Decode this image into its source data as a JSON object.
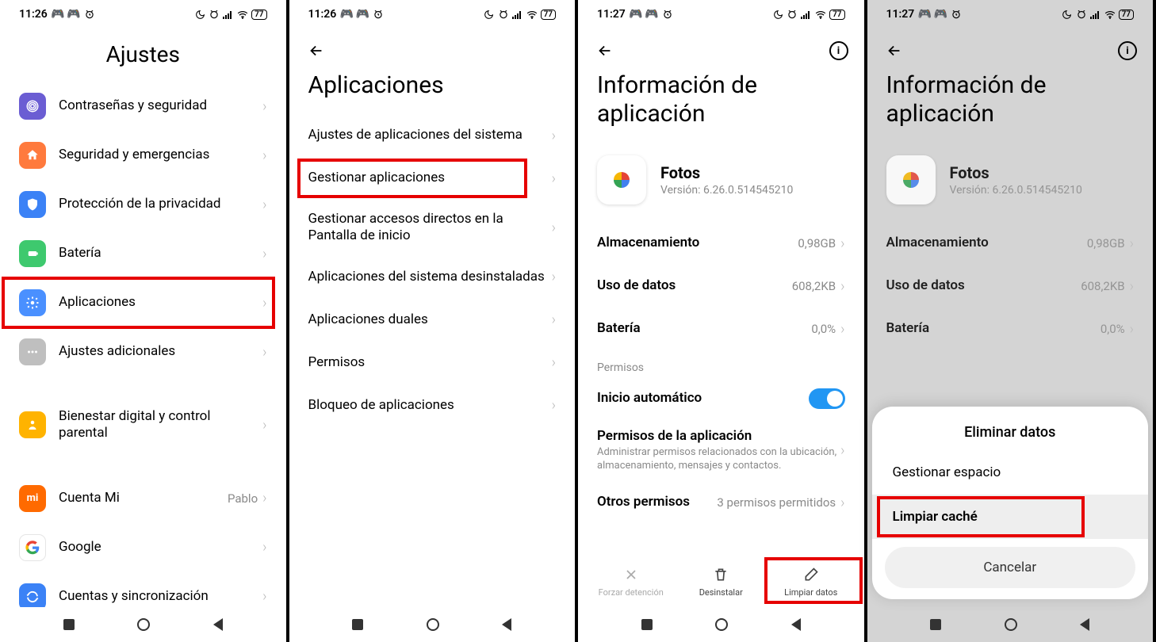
{
  "status": {
    "time1": "11:26",
    "time2": "11:27",
    "battery": "77"
  },
  "screen1": {
    "title": "Ajustes",
    "items": [
      {
        "label": "Contraseñas y seguridad"
      },
      {
        "label": "Seguridad y emergencias"
      },
      {
        "label": "Protección de la privacidad"
      },
      {
        "label": "Batería"
      },
      {
        "label": "Aplicaciones"
      },
      {
        "label": "Ajustes adicionales"
      },
      {
        "label": "Bienestar digital y control parental"
      },
      {
        "label": "Cuenta Mi",
        "value": "Pablo"
      },
      {
        "label": "Google"
      },
      {
        "label": "Cuentas y sincronización"
      }
    ]
  },
  "screen2": {
    "title": "Aplicaciones",
    "items": [
      {
        "label": "Ajustes de aplicaciones del sistema"
      },
      {
        "label": "Gestionar aplicaciones"
      },
      {
        "label": "Gestionar accesos directos en la Pantalla de inicio"
      },
      {
        "label": "Aplicaciones del sistema desinstaladas"
      },
      {
        "label": "Aplicaciones duales"
      },
      {
        "label": "Permisos"
      },
      {
        "label": "Bloqueo de aplicaciones"
      }
    ]
  },
  "screen3": {
    "title": "Información de aplicación",
    "app_name": "Fotos",
    "app_version": "Versión: 6.26.0.514545210",
    "rows": [
      {
        "label": "Almacenamiento",
        "value": "0,98GB"
      },
      {
        "label": "Uso de datos",
        "value": "608,2KB"
      },
      {
        "label": "Batería",
        "value": "0,0%"
      }
    ],
    "section_permisos": "Permisos",
    "autostart": "Inicio automático",
    "app_perms_title": "Permisos de la aplicación",
    "app_perms_sub": "Administrar permisos relacionados con la ubicación, almacenamiento, mensajes y contactos.",
    "other_perms": "Otros permisos",
    "other_perms_value": "3 permisos permitidos",
    "actions": {
      "forcestop": "Forzar detención",
      "uninstall": "Desinstalar",
      "cleardata": "Limpiar datos"
    }
  },
  "screen4": {
    "dialog_title": "Eliminar datos",
    "opt_manage": "Gestionar espacio",
    "opt_clear": "Limpiar caché",
    "cancel": "Cancelar"
  }
}
